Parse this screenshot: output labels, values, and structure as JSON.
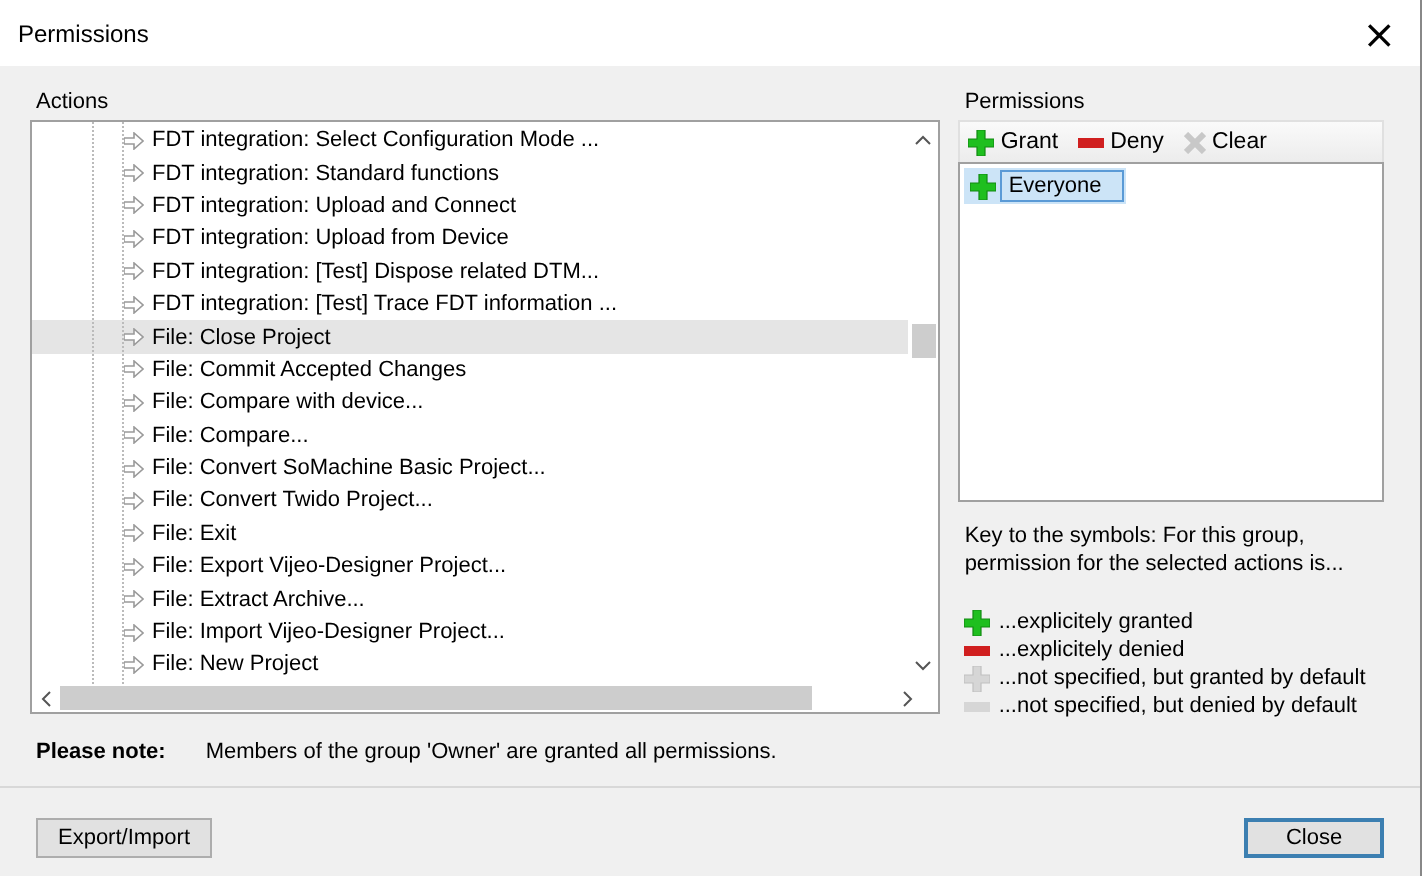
{
  "window": {
    "title": "Permissions",
    "close": "×"
  },
  "actions": {
    "label": "Actions",
    "rows": [
      {
        "text": "FDT integration: Select Configuration Mode ...",
        "selected": false
      },
      {
        "text": "FDT integration: Standard functions",
        "selected": false
      },
      {
        "text": "FDT integration: Upload and Connect",
        "selected": false
      },
      {
        "text": "FDT integration: Upload from Device",
        "selected": false
      },
      {
        "text": "FDT integration: [Test] Dispose related DTM...",
        "selected": false
      },
      {
        "text": "FDT integration: [Test] Trace FDT information ...",
        "selected": false
      },
      {
        "text": "File: Close Project",
        "selected": true
      },
      {
        "text": "File: Commit Accepted Changes",
        "selected": false
      },
      {
        "text": "File: Compare with device...",
        "selected": false
      },
      {
        "text": "File: Compare...",
        "selected": false
      },
      {
        "text": "File: Convert SoMachine Basic Project...",
        "selected": false
      },
      {
        "text": "File: Convert Twido Project...",
        "selected": false
      },
      {
        "text": "File: Exit",
        "selected": false
      },
      {
        "text": "File: Export Vijeo-Designer Project...",
        "selected": false
      },
      {
        "text": "File: Extract Archive...",
        "selected": false
      },
      {
        "text": "File: Import Vijeo-Designer Project...",
        "selected": false
      },
      {
        "text": "File: New Project",
        "selected": false
      }
    ]
  },
  "permissions": {
    "label": "Permissions",
    "toolbar": [
      {
        "kind": "granted",
        "label": "Grant",
        "disabled": false
      },
      {
        "kind": "denied",
        "label": "Deny",
        "disabled": false
      },
      {
        "kind": "clear",
        "label": "Clear",
        "disabled": false
      }
    ],
    "groups": [
      {
        "name": "Everyone",
        "kind": "granted",
        "selected": true
      }
    ],
    "key_text": "Key to the symbols: For this group, permission for the selected actions is...",
    "legend": [
      {
        "kind": "granted",
        "text": "...explicitely granted"
      },
      {
        "kind": "denied",
        "text": "...explicitely denied"
      },
      {
        "kind": "default_granted",
        "text": "...not specified, but granted by default"
      },
      {
        "kind": "default_denied",
        "text": "...not specified, but denied by default"
      }
    ]
  },
  "note": {
    "label": "Please note:",
    "text": "Members of the group 'Owner' are granted all permissions."
  },
  "buttons": [
    {
      "label": "Export/Import",
      "default": false
    },
    {
      "label": "Close",
      "default": true
    }
  ]
}
